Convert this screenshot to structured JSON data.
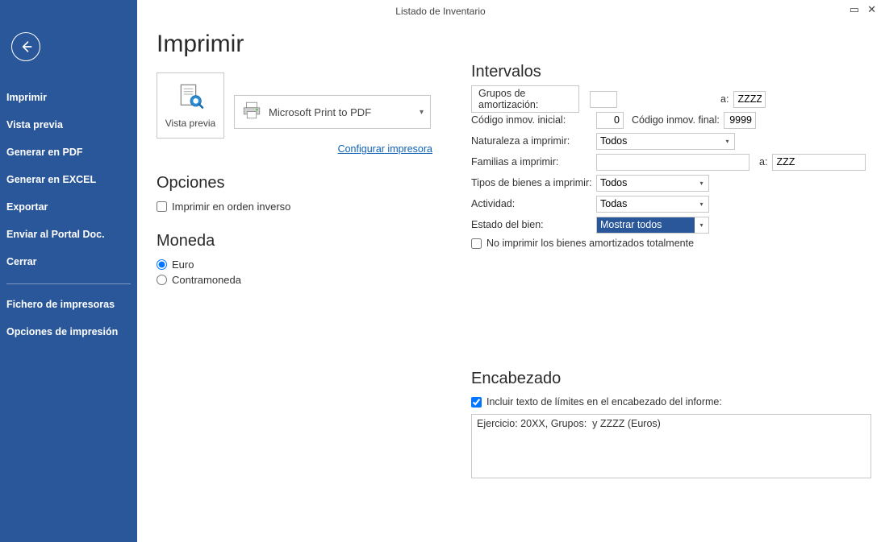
{
  "window": {
    "title": "Listado de Inventario"
  },
  "sidebar": {
    "items": [
      "Imprimir",
      "Vista previa",
      "Generar en PDF",
      "Generar en EXCEL",
      "Exportar",
      "Enviar al Portal Doc.",
      "Cerrar"
    ],
    "footer_items": [
      "Fichero de impresoras",
      "Opciones de impresión"
    ]
  },
  "page": {
    "title": "Imprimir",
    "preview_label": "Vista previa",
    "printer_name": "Microsoft Print to PDF",
    "config_printer": "Configurar impresora"
  },
  "options": {
    "heading": "Opciones",
    "reverse_order_label": "Imprimir en orden inverso",
    "reverse_order_checked": false
  },
  "currency": {
    "heading": "Moneda",
    "euro_label": "Euro",
    "contramoneda_label": "Contramoneda",
    "selected": "euro"
  },
  "intervals": {
    "heading": "Intervalos",
    "grupos_btn": "Grupos de amortización:",
    "grupos_from": "",
    "grupos_a_label": "a:",
    "grupos_to": "ZZZZ",
    "codigo_inicial_label": "Código inmov. inicial:",
    "codigo_inicial_value": "0",
    "codigo_final_label": "Código inmov. final:",
    "codigo_final_value": "9999",
    "naturaleza_label": "Naturaleza a imprimir:",
    "naturaleza_value": "Todos",
    "familias_label": "Familias a imprimir:",
    "familias_from": "",
    "familias_a_label": "a:",
    "familias_to": "ZZZ",
    "tipos_label": "Tipos de bienes a imprimir:",
    "tipos_value": "Todos",
    "actividad_label": "Actividad:",
    "actividad_value": "Todas",
    "estado_label": "Estado del bien:",
    "estado_value": "Mostrar todos",
    "no_imprimir_label": "No imprimir los bienes amortizados totalmente",
    "no_imprimir_checked": false
  },
  "header": {
    "heading": "Encabezado",
    "incluir_label": "Incluir texto de límites en el encabezado del informe:",
    "incluir_checked": true,
    "text": "Ejercicio: 20XX, Grupos:  y ZZZZ (Euros)"
  }
}
